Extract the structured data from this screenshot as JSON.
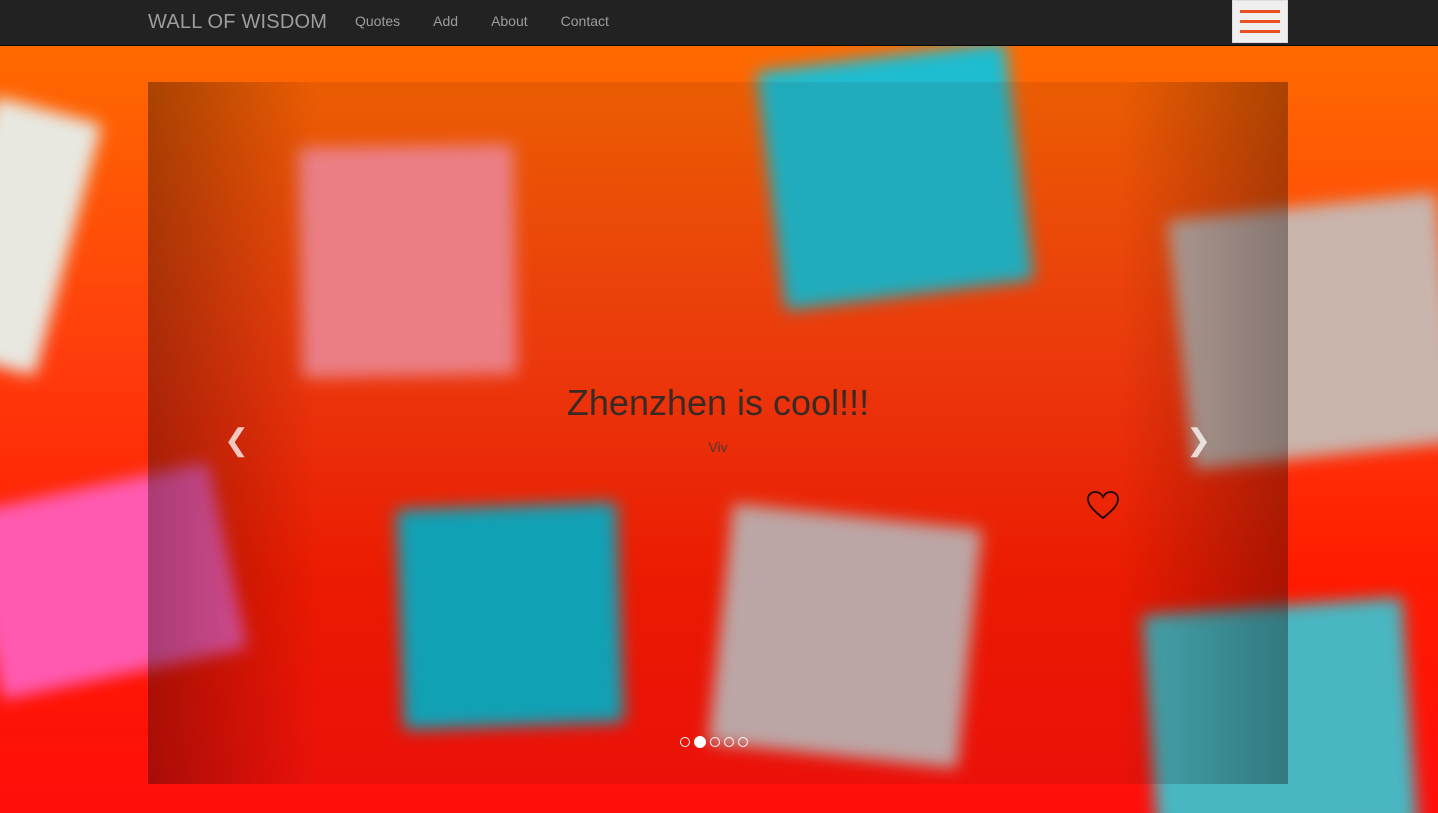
{
  "navbar": {
    "brand": "WALL OF WISDOM",
    "links": [
      "Quotes",
      "Add",
      "About",
      "Contact"
    ],
    "menu_icon": "hamburger-icon",
    "menu_color": "#e8501f"
  },
  "carousel": {
    "quote": "Zhenzhen is cool!!!",
    "author": "Viv",
    "prev_icon": "chevron-left-icon",
    "next_icon": "chevron-right-icon",
    "prev_glyph": "❮",
    "next_glyph": "❯",
    "like_icon": "heart-icon",
    "slide_count": 5,
    "active_slide": 2
  }
}
